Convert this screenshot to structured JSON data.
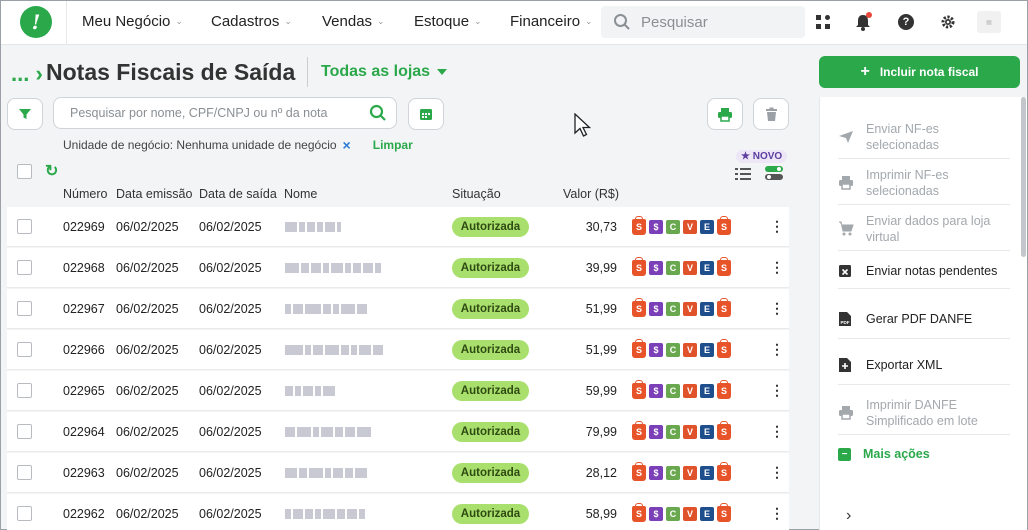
{
  "nav": {
    "items": [
      "Meu Negócio",
      "Cadastros",
      "Vendas",
      "Estoque",
      "Financeiro"
    ],
    "search_placeholder": "Pesquisar",
    "logo_glyph": "!"
  },
  "header": {
    "breadcrumb": "...",
    "title": "Notas Fiscais de Saída",
    "store_selector": "Todas as lojas"
  },
  "filters": {
    "search_placeholder": "Pesquisar por nome, CPF/CNPJ ou nº da nota",
    "active_filter": "Unidade de negócio: Nenhuma unidade de negócio",
    "clear_label": "Limpar",
    "novo_badge": "NOVO"
  },
  "table": {
    "columns": [
      "Número",
      "Data emissão",
      "Data de saída",
      "Nome",
      "Situação",
      "Valor (R$)"
    ],
    "rows": [
      {
        "numero": "022969",
        "emissao": "06/02/2025",
        "saida": "06/02/2025",
        "situacao": "Autorizada",
        "valor": "30,73"
      },
      {
        "numero": "022968",
        "emissao": "06/02/2025",
        "saida": "06/02/2025",
        "situacao": "Autorizada",
        "valor": "39,99"
      },
      {
        "numero": "022967",
        "emissao": "06/02/2025",
        "saida": "06/02/2025",
        "situacao": "Autorizada",
        "valor": "51,99"
      },
      {
        "numero": "022966",
        "emissao": "06/02/2025",
        "saida": "06/02/2025",
        "situacao": "Autorizada",
        "valor": "51,99"
      },
      {
        "numero": "022965",
        "emissao": "06/02/2025",
        "saida": "06/02/2025",
        "situacao": "Autorizada",
        "valor": "59,99"
      },
      {
        "numero": "022964",
        "emissao": "06/02/2025",
        "saida": "06/02/2025",
        "situacao": "Autorizada",
        "valor": "79,99"
      },
      {
        "numero": "022963",
        "emissao": "06/02/2025",
        "saida": "06/02/2025",
        "situacao": "Autorizada",
        "valor": "28,12"
      },
      {
        "numero": "022962",
        "emissao": "06/02/2025",
        "saida": "06/02/2025",
        "situacao": "Autorizada",
        "valor": "58,99"
      }
    ],
    "row_badges": [
      {
        "label": "$",
        "color": "#7b3fb8",
        "icon": "dollar-icon"
      },
      {
        "label": "C",
        "color": "#6aa84f",
        "icon": "c-badge-icon"
      },
      {
        "label": "V",
        "color": "#e0522a",
        "icon": "v-badge-icon"
      },
      {
        "label": "E",
        "color": "#1f4e8c",
        "icon": "e-badge-icon"
      }
    ],
    "bag_glyph": "S"
  },
  "panel": {
    "add_button": "Incluir nota fiscal",
    "actions": [
      {
        "label": "Enviar NF-es selecionadas",
        "enabled": false,
        "icon": "send-icon"
      },
      {
        "label": "Imprimir NF-es selecionadas",
        "enabled": false,
        "icon": "printer-icon"
      },
      {
        "label": "Enviar dados para loja virtual",
        "enabled": false,
        "icon": "cart-icon"
      },
      {
        "label": "Enviar notas pendentes",
        "enabled": true,
        "icon": "calendar-x-icon"
      },
      {
        "label": "Gerar PDF DANFE",
        "enabled": true,
        "icon": "pdf-icon"
      },
      {
        "label": "Exportar XML",
        "enabled": true,
        "icon": "export-file-icon"
      },
      {
        "label": "Imprimir DANFE Simplificado em lote",
        "enabled": false,
        "icon": "printer-icon"
      }
    ],
    "more_actions": "Mais ações"
  },
  "colors": {
    "accent": "#2aa84a",
    "status_bg": "#a9e06d",
    "bag": "#e8542a"
  }
}
